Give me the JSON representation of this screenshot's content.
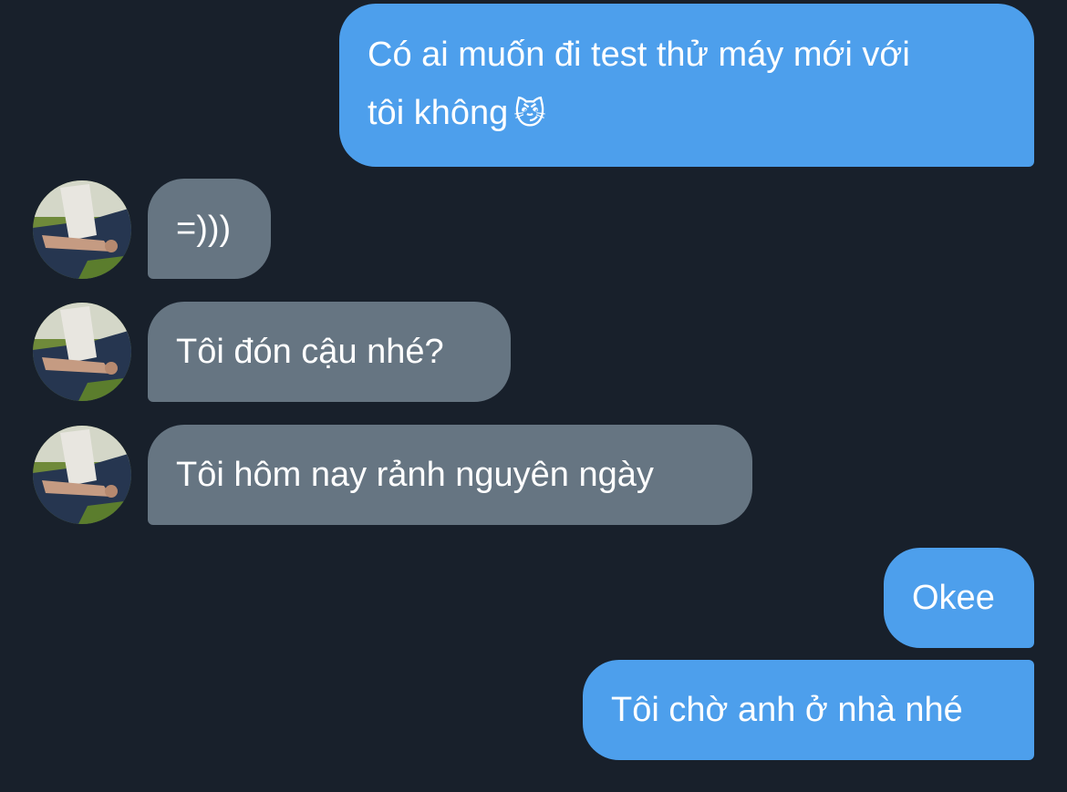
{
  "conversation": {
    "messages": [
      {
        "direction": "outgoing",
        "text": "Có ai muốn đi test thử máy mới với",
        "text_line2": "tôi không",
        "emoji": "😼"
      },
      {
        "direction": "incoming",
        "text": "=)))",
        "avatar": "contact-avatar"
      },
      {
        "direction": "incoming",
        "text": "Tôi đón cậu nhé?",
        "avatar": "contact-avatar"
      },
      {
        "direction": "incoming",
        "text": "Tôi hôm nay rảnh nguyên ngày",
        "avatar": "contact-avatar"
      },
      {
        "direction": "outgoing",
        "text": "Okee"
      },
      {
        "direction": "outgoing",
        "text": "Tôi chờ anh ở nhà nhé"
      }
    ]
  },
  "colors": {
    "background": "#18202b",
    "outgoing_bubble": "#4d9fec",
    "incoming_bubble": "#667582",
    "text": "#ffffff"
  }
}
